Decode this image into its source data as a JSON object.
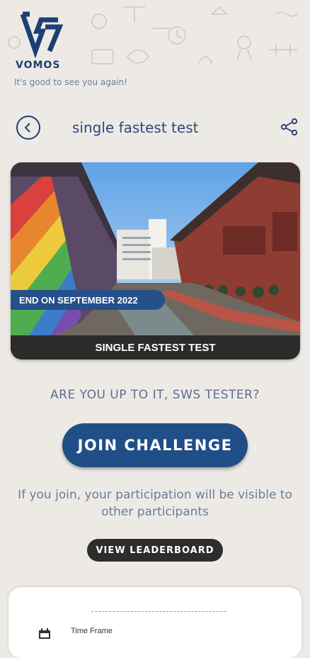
{
  "brand": {
    "name": "VOMOS"
  },
  "greeting": "It's good to see you again!",
  "header": {
    "title": "single fastest test"
  },
  "challenge_card": {
    "end_banner": "END ON SEPTEMBER 2022",
    "footer_title": "SINGLE FASTEST TEST"
  },
  "prompt": "ARE YOU UP TO IT, SWS TESTER?",
  "join_button": "JOIN CHALLENGE",
  "participation_note": "If you join, your participation will be visible to other participants",
  "leaderboard_button": "VIEW LEADERBOARD",
  "details": {
    "time_frame_label": "Time Frame"
  },
  "colors": {
    "primary": "#204f87",
    "dark": "#2d2d2d",
    "background": "#edeae6"
  },
  "icons": {
    "back": "chevron-left-icon",
    "share": "share-icon",
    "calendar": "calendar-icon"
  }
}
